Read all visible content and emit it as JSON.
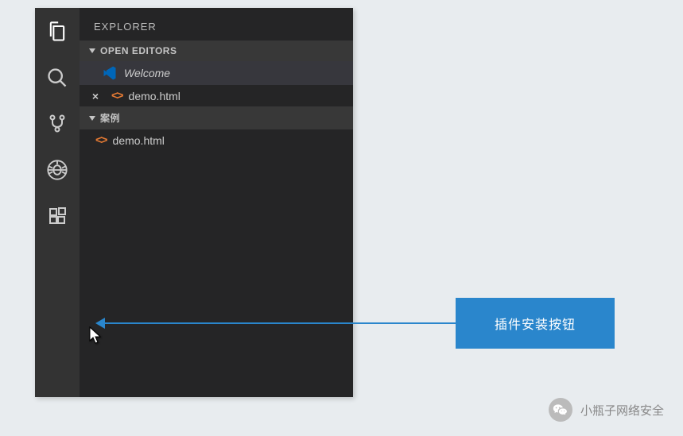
{
  "sidebar": {
    "title": "EXPLORER",
    "sections": {
      "openEditors": {
        "label": "OPEN EDITORS",
        "items": [
          {
            "label": "Welcome",
            "icon": "vscode-logo"
          },
          {
            "label": "demo.html",
            "icon": "html",
            "closable": true
          }
        ]
      },
      "folder": {
        "label": "案例",
        "items": [
          {
            "label": "demo.html",
            "icon": "html"
          }
        ]
      }
    }
  },
  "callout": {
    "label": "插件安装按钮"
  },
  "footer": {
    "label": "小瓶子网络安全"
  }
}
